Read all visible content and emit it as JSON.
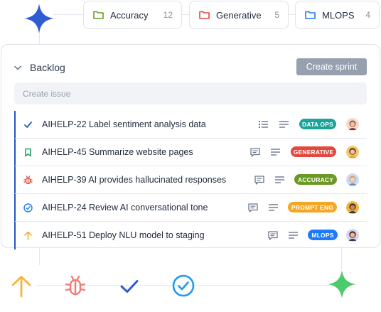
{
  "top_chips": [
    {
      "label": "Accuracy",
      "count": "12",
      "color": "#6a9a23",
      "icon": "folder-icon"
    },
    {
      "label": "Generative",
      "count": "5",
      "color": "#e2483d",
      "icon": "folder-icon"
    },
    {
      "label": "MLOPS",
      "count": "4",
      "color": "#1d7afc",
      "icon": "folder-icon"
    }
  ],
  "backlog": {
    "title": "Backlog",
    "create_sprint_label": "Create sprint",
    "create_issue_placeholder": "Create issue"
  },
  "issues": [
    {
      "type_icon": "check-task-icon",
      "type_color": "#2457c5",
      "text": "AIHELP-22 Label sentiment analysis data",
      "icon_a": "checklist-icon",
      "icon_b": "description-lines-icon",
      "badge": "DATA OPS",
      "badge_color": "#1aa39a"
    },
    {
      "type_icon": "bookmark-story-icon",
      "type_color": "#22a06b",
      "text": "AIHELP-45 Summarize website pages",
      "icon_a": "comment-icon",
      "icon_b": "description-lines-icon",
      "badge": "GENERATIVE",
      "badge_color": "#e2483d"
    },
    {
      "type_icon": "bug-icon",
      "type_color": "#e2483d",
      "text": "AIHELP-39 AI provides hallucinated responses",
      "icon_a": "comment-icon",
      "icon_b": "description-lines-icon",
      "badge": "ACCURACY",
      "badge_color": "#6a9a23"
    },
    {
      "type_icon": "circle-check-icon",
      "type_color": "#1d7afc",
      "text": "AIHELP-24 Review AI conversational tone",
      "icon_a": "comment-icon",
      "icon_b": "description-lines-icon",
      "badge": "PROMPT ENG",
      "badge_color": "#f5a623"
    },
    {
      "type_icon": "arrow-up-icon",
      "type_color": "#f5a623",
      "text": "AIHELP-51 Deploy NLU model to staging",
      "icon_a": "comment-icon",
      "icon_b": "description-lines-icon",
      "badge": "MLOPS",
      "badge_color": "#1d7afc"
    }
  ],
  "bottom_icons": [
    {
      "name": "arrow-up-icon",
      "color": "#f5b73b"
    },
    {
      "name": "bug-icon",
      "color": "#f07a7a"
    },
    {
      "name": "check-icon",
      "color": "#2f5bd3"
    },
    {
      "name": "circle-check-icon",
      "color": "#1d9bf0"
    }
  ],
  "colors": {
    "accent_blue": "#2457c5",
    "sparkle_blue": "#2f5bd3",
    "sparkle_green": "#4ccb6a"
  }
}
